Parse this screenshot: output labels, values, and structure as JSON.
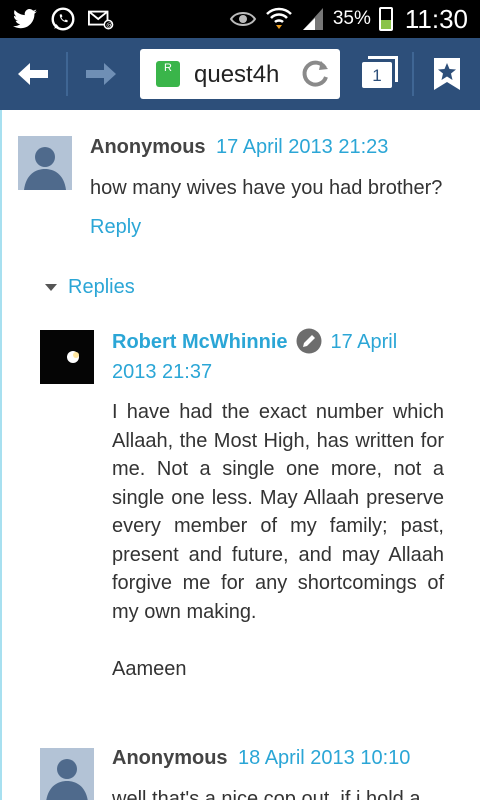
{
  "statusbar": {
    "battery_percent": "35%",
    "time": "11:30",
    "icons": [
      "twitter-icon",
      "whatsapp-icon",
      "email-icon",
      "eye-icon",
      "wifi-icon",
      "signal-icon",
      "battery-icon"
    ]
  },
  "toolbar": {
    "url_text": "quest4h",
    "tab_count": "1"
  },
  "comments": {
    "c1": {
      "author": "Anonymous",
      "date": "17 April 2013 21:23",
      "text": "how many wives have you had brother?",
      "reply_label": "Reply"
    },
    "replies_label": "Replies",
    "c2": {
      "author": "Robert McWhinnie",
      "date": "17 April 2013 21:37",
      "paragraph": "I have had the exact number which Allaah, the Most High, has written for me. Not a single one more, not a single one less. May Allaah preserve every member of my family; past, present and future, and may Allaah forgive me for any shortcomings of my own making.",
      "closing": "Aameen"
    },
    "c3": {
      "author": "Anonymous",
      "date": "18 April 2013 10:10",
      "text_partial": "well that's a nice cop out, if i hold a"
    }
  }
}
